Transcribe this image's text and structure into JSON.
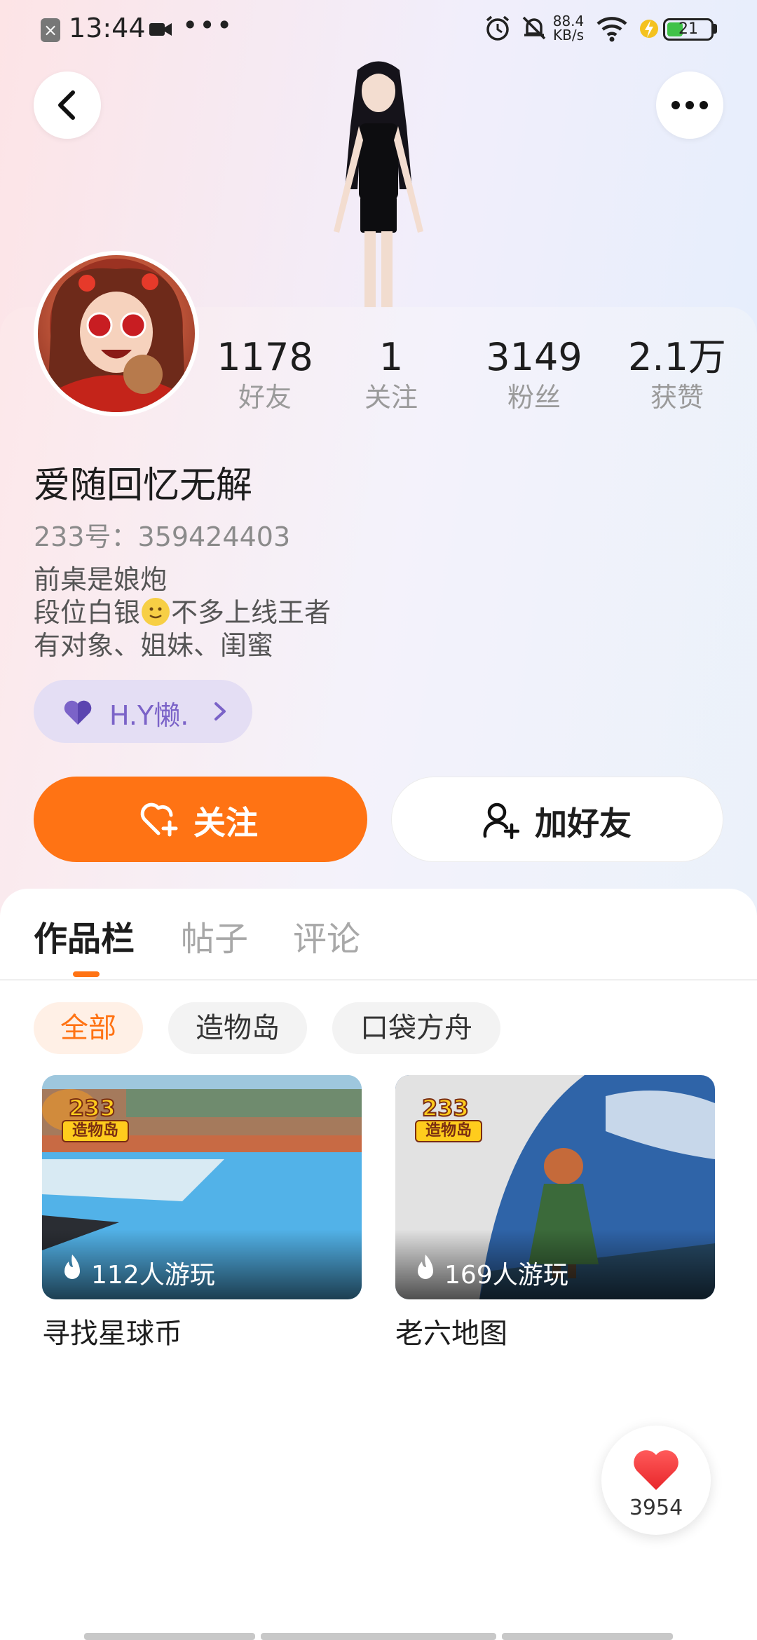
{
  "status_bar": {
    "time": "13:44",
    "dots": "•••",
    "network_speed_value": "88.4",
    "network_speed_unit": "KB/s",
    "battery_level": "21"
  },
  "profile": {
    "name": "爱随回忆无解",
    "uid": "233号：359424403",
    "bio": [
      "前桌是娘炮",
      "段位白银",
      "不多上线王者",
      "有对象、姐妹、闺蜜"
    ],
    "stats": [
      {
        "value": "1178",
        "label": "好友"
      },
      {
        "value": "1",
        "label": "关注"
      },
      {
        "value": "3149",
        "label": "粉丝"
      },
      {
        "value": "2.1万",
        "label": "获赞"
      }
    ],
    "cp_tag": "H.Y懒."
  },
  "actions": {
    "follow": "关注",
    "add_friend": "加好友"
  },
  "tabs": [
    "作品栏",
    "帖子",
    "评论"
  ],
  "filters": [
    "全部",
    "造物岛",
    "口袋方舟"
  ],
  "games": [
    {
      "title": "寻找星球币",
      "plays": "112人游玩",
      "badge_num": "233",
      "badge_text": "造物岛"
    },
    {
      "title": "老六地图",
      "plays": "169人游玩",
      "badge_num": "233",
      "badge_text": "造物岛"
    }
  ],
  "like_fab": {
    "count": "3954"
  },
  "colors": {
    "accent": "#ff7314",
    "pill_bg": "#e4def4",
    "pill_text": "#7b63c8"
  }
}
